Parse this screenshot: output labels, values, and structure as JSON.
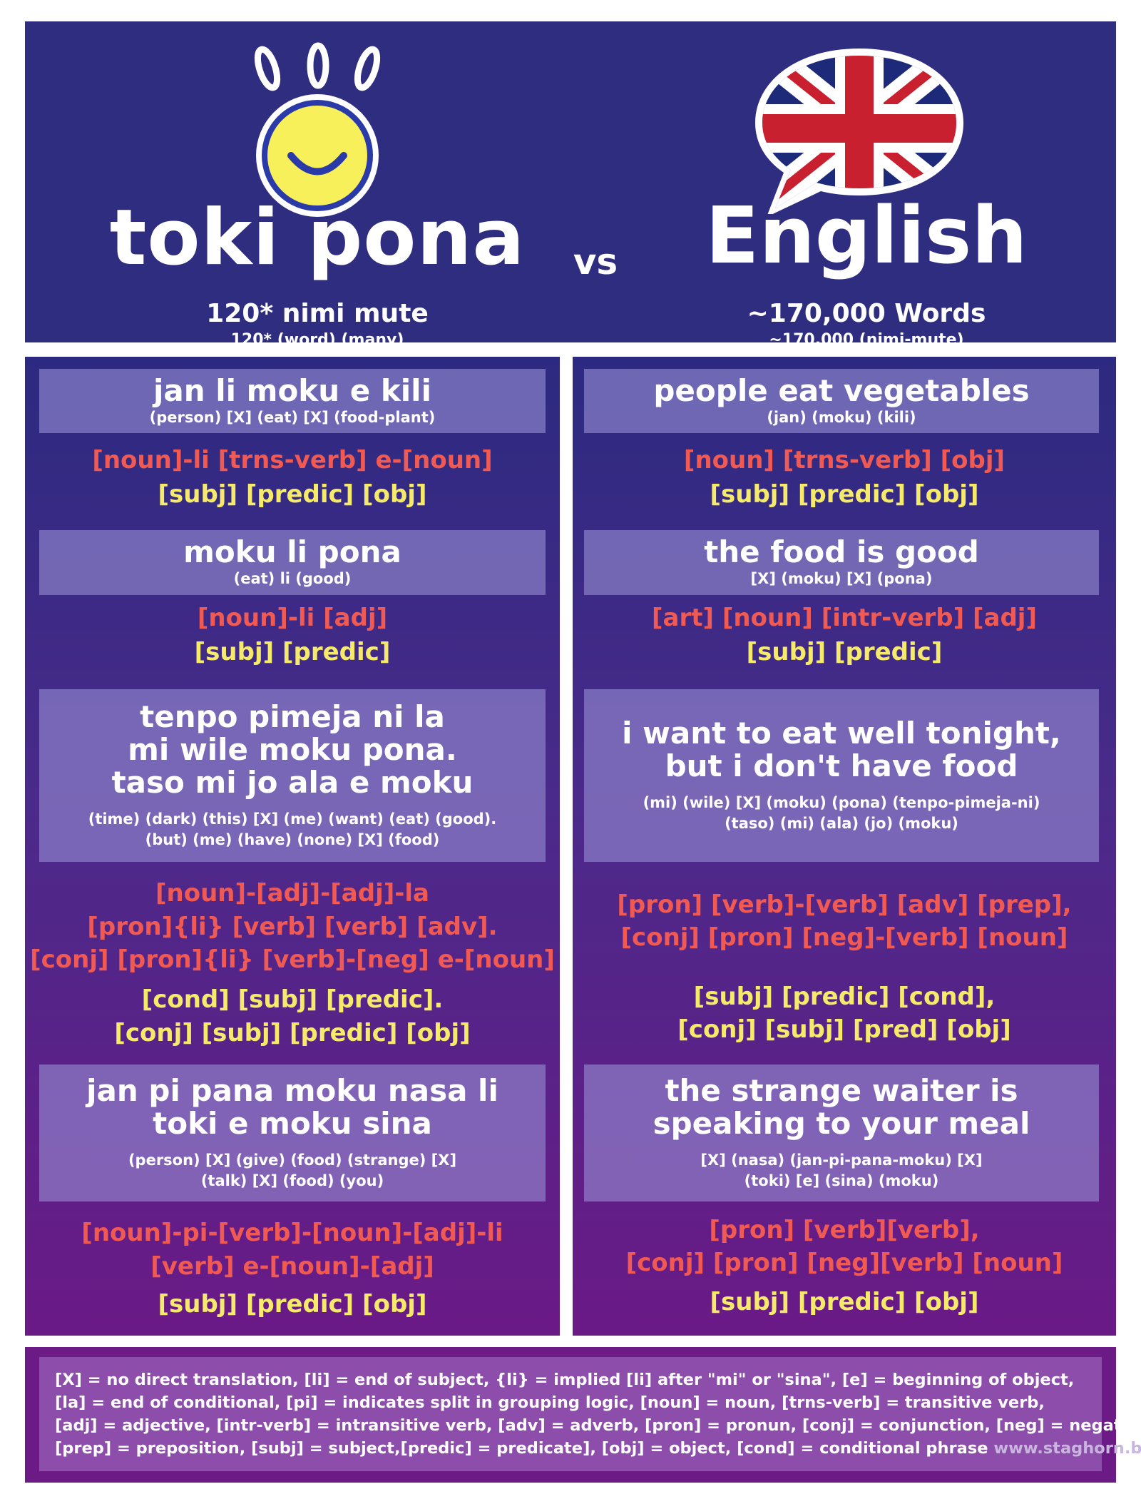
{
  "header": {
    "toki_pona": {
      "title": "toki pona",
      "count": "120* nimi mute",
      "gloss": "120* (word) (many)"
    },
    "vs": "vs",
    "english": {
      "title": "English",
      "count": "~170,000 Words",
      "gloss": "~170,000 (nimi-mute)"
    },
    "colors": {
      "background": "#2e2d80",
      "smiley_yellow": "#f7f05a",
      "smiley_blue": "#2a3aa8"
    }
  },
  "toki_pona_column": [
    {
      "phrase_lines": [
        "jan li moku e kili"
      ],
      "gloss_lines": [
        "(person) [X] (eat) [X] (food-plant)"
      ],
      "grammar_lines": [
        "[noun]-li [trns-verb] e-[noun]"
      ],
      "role_lines": [
        "[subj] [predic] [obj]"
      ]
    },
    {
      "phrase_lines": [
        "moku li pona"
      ],
      "gloss_lines": [
        "(eat) li (good)"
      ],
      "grammar_lines": [
        "[noun]-li [adj]"
      ],
      "role_lines": [
        "[subj] [predic]"
      ]
    },
    {
      "phrase_lines": [
        "tenpo pimeja ni la",
        "mi wile moku pona.",
        "taso mi jo ala e moku"
      ],
      "gloss_lines": [
        "(time) (dark) (this) [X] (me) (want) (eat) (good).",
        "(but) (me) (have) (none) [X] (food)"
      ],
      "grammar_lines": [
        "[noun]-[adj]-[adj]-la",
        "[pron]{li} [verb] [verb] [adv].",
        "[conj] [pron]{li} [verb]-[neg] e-[noun]"
      ],
      "role_lines": [
        "[cond] [subj] [predic].",
        "[conj] [subj] [predic] [obj]"
      ]
    },
    {
      "phrase_lines": [
        "jan pi pana moku nasa li",
        "toki e moku sina"
      ],
      "gloss_lines": [
        "(person) [X] (give) (food) (strange) [X]",
        "(talk) [X] (food) (you)"
      ],
      "grammar_lines": [
        "[noun]-pi-[verb]-[noun]-[adj]-li",
        "[verb] e-[noun]-[adj]"
      ],
      "role_lines": [
        "[subj] [predic] [obj]"
      ]
    }
  ],
  "english_column": [
    {
      "phrase_lines": [
        "people eat vegetables"
      ],
      "gloss_lines": [
        "(jan) (moku) (kili)"
      ],
      "grammar_lines": [
        "[noun] [trns-verb] [obj]"
      ],
      "role_lines": [
        "[subj] [predic] [obj]"
      ]
    },
    {
      "phrase_lines": [
        "the food is good"
      ],
      "gloss_lines": [
        "[X] (moku) [X] (pona)"
      ],
      "grammar_lines": [
        "[art] [noun] [intr-verb] [adj]"
      ],
      "role_lines": [
        "[subj] [predic]"
      ]
    },
    {
      "phrase_lines": [
        "i want to eat well tonight,",
        "but i don't have food"
      ],
      "gloss_lines": [
        "(mi) (wile) [X] (moku) (pona) (tenpo-pimeja-ni)",
        "(taso) (mi) (ala) (jo) (moku)"
      ],
      "grammar_lines": [
        "[pron] [verb]-[verb] [adv] [prep],",
        "[conj] [pron] [neg]-[verb] [noun]"
      ],
      "role_lines": [
        "[subj] [predic] [cond],",
        "[conj] [subj] [pred] [obj]"
      ]
    },
    {
      "phrase_lines": [
        "the strange waiter is",
        "speaking to your meal"
      ],
      "gloss_lines": [
        "[X] (nasa) (jan-pi-pana-moku) [X]",
        "(toki) [e] (sina) (moku)"
      ],
      "grammar_lines": [
        "[pron] [verb][verb],",
        "[conj] [pron] [neg][verb] [noun]"
      ],
      "role_lines": [
        "[subj] [predic] [obj]"
      ]
    }
  ],
  "legend": {
    "lines": [
      "[X] = no direct translation, [li] = end of subject, {li} = implied [li] after \"mi\" or \"sina\", [e] = beginning of object,",
      "[la] = end of conditional,  [pi] = indicates split in grouping logic,  [noun] = noun,  [trns-verb] = transitive verb,",
      "[adj] = adjective, [intr-verb] = intransitive verb, [adv] = adverb, [pron] = pronun, [conj] = conjunction, [neg] = negator,",
      "[prep] = preposition, [subj] = subject,[predic] = predicate], [obj] = object, [cond] = conditional phrase"
    ],
    "site": "www.staghorn.blog"
  },
  "colors": {
    "grammar_red": "#f15a52",
    "role_yellow": "#f6ea6b",
    "box_lavender": "#8c82c8",
    "column_top": "#2c2a80",
    "column_bottom": "#6a1a86"
  }
}
